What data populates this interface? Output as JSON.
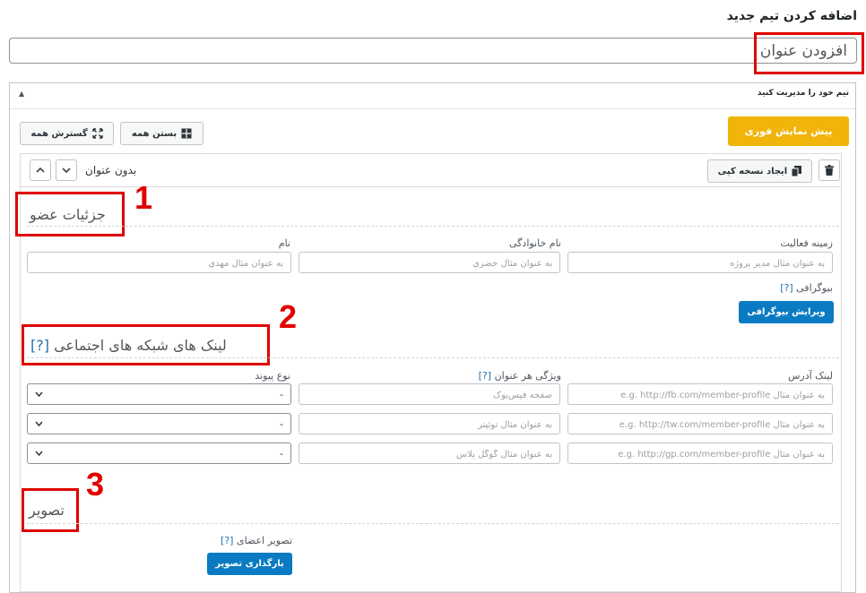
{
  "page": {
    "title": "اضافه کردن تیم جدید"
  },
  "title_field": {
    "placeholder": "افزودن عنوان"
  },
  "metabox": {
    "title": "تیم خود را مدیریت کنید",
    "toggle_glyph": "▲"
  },
  "toolbar": {
    "preview_label": "پیش نمایش فوری",
    "expand_all_label": "گسترش همه",
    "collapse_all_label": "بستن همه"
  },
  "member_item": {
    "title": "بدون عنوان",
    "duplicate_label": "ایجاد نسخه کپی",
    "move_up_glyph": "⌃",
    "move_down_glyph": "⌄"
  },
  "annotations": {
    "marker_1": "1",
    "marker_2": "2",
    "marker_3": "3"
  },
  "member_details": {
    "section_title": "جزئیات عضو",
    "fields": {
      "activity": {
        "label": "زمینه فعالیت",
        "placeholder": "به عنوان مثال مدیر پروژه"
      },
      "last_name": {
        "label": "نام خانوادگی",
        "placeholder": "به عنوان مثال خضری"
      },
      "first_name": {
        "label": "نام",
        "placeholder": "به عنوان مثال مهدی"
      }
    },
    "biography": {
      "label": "بیوگرافی",
      "help": "[?]",
      "button_label": "ویرایش بیوگرافی"
    }
  },
  "social_links": {
    "section_title": "لینک های شبکه های اجتماعی",
    "section_help": "[?]",
    "columns": {
      "address": "لینک آدرس",
      "attribute": "ویژگی هر عنوان",
      "attribute_help": "[?]",
      "link_type": "نوع پیوند"
    },
    "rows": [
      {
        "address_placeholder": "به عنوان مثال e.g. http://fb.com/member-profile",
        "attribute_placeholder": "صفحه فیس‌بوک",
        "link_type_value": "-"
      },
      {
        "address_placeholder": "به عنوان مثال e.g. http://tw.com/member-profile",
        "attribute_placeholder": "به عنوان مثال توئیتر",
        "link_type_value": "-"
      },
      {
        "address_placeholder": "به عنوان مثال e.g. http://gp.com/member-profile",
        "attribute_placeholder": "به عنوان مثال گوگل پلاس",
        "link_type_value": "-"
      }
    ]
  },
  "photo": {
    "section_title": "تصویر",
    "label": "تصویر اعضای",
    "help": "[?]",
    "upload_button_label": "بارگذاری تصویر"
  },
  "colors": {
    "accent_red": "#e00000",
    "preview_yellow": "#f0b40a",
    "primary_blue": "#0a7bc2",
    "link_blue": "#2271b1"
  },
  "icons": [
    "trash-icon",
    "copy-icon",
    "expand-icon",
    "collapse-icon",
    "chevron-up-icon",
    "chevron-down-icon",
    "dropdown-arrow-icon"
  ]
}
